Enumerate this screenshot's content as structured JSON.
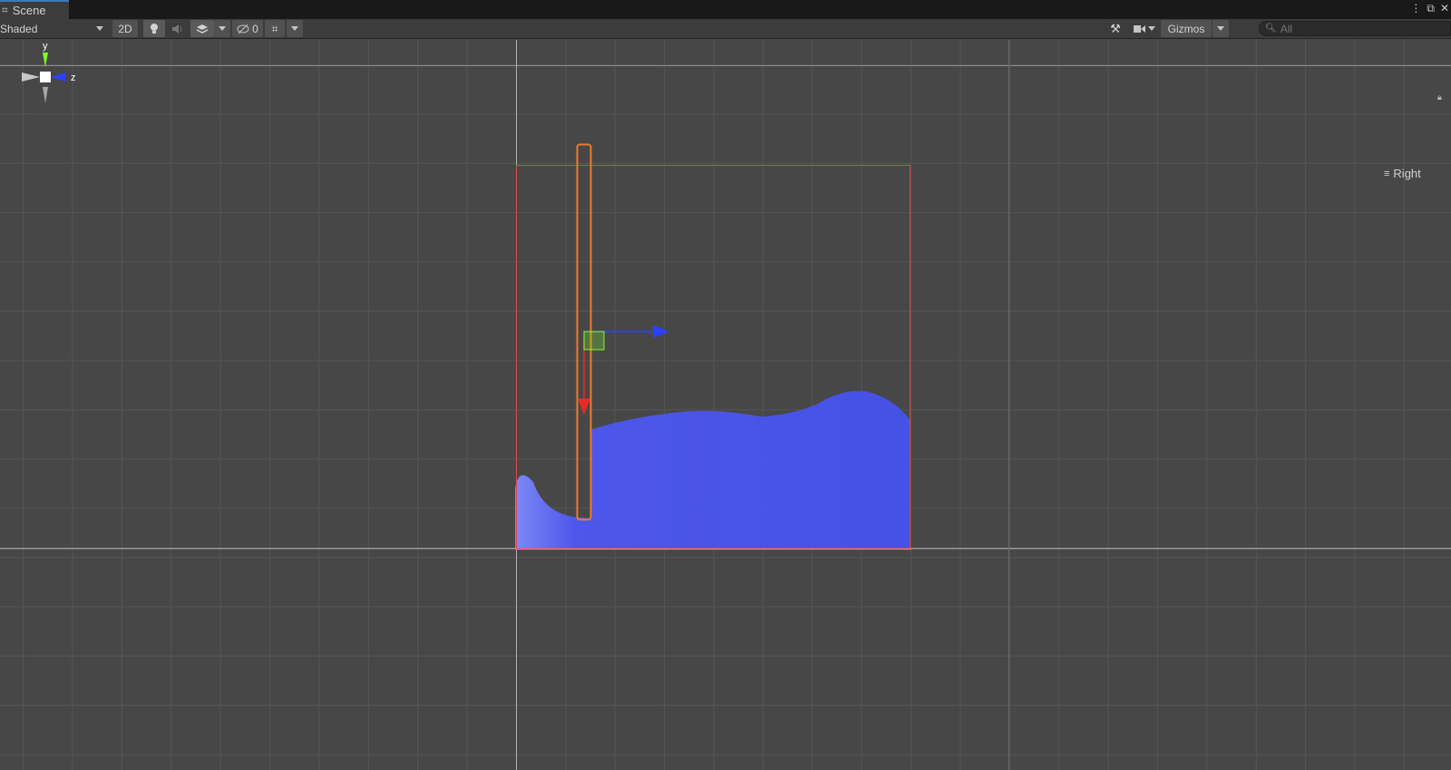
{
  "tab": {
    "icon": "grid-icon",
    "title": "Scene"
  },
  "toolbar": {
    "shading_mode": "Shaded",
    "mode_2d": "2D",
    "hidden_count": "0",
    "gizmos_label": "Gizmos",
    "search_placeholder": "All"
  },
  "viewport": {
    "orientation": {
      "y": "y",
      "z": "z",
      "view": "Right"
    }
  },
  "colors": {
    "fluid": "#4a57f5",
    "bounds": "#e84a4a",
    "selection": "#f07a2a",
    "gizmo_y": "#7dff2a",
    "gizmo_z": "#2a42ff",
    "tab_accent": "#3a79bb"
  }
}
